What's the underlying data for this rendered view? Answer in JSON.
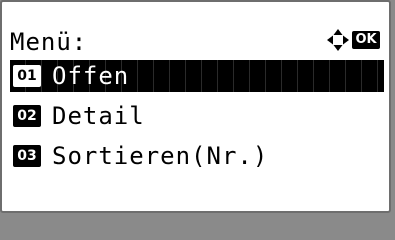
{
  "screen": {
    "title": "Menü:",
    "nav_icon": "four-way-arrow-icon",
    "ok_label": "OK"
  },
  "menu": {
    "items": [
      {
        "number": "01",
        "label": "Offen",
        "selected": true
      },
      {
        "number": "02",
        "label": "Detail",
        "selected": false
      },
      {
        "number": "03",
        "label": "Sortieren(Nr.)",
        "selected": false
      }
    ]
  }
}
